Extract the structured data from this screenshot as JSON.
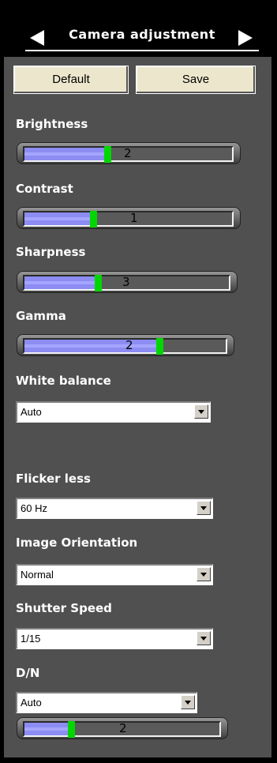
{
  "header": {
    "title": "Camera adjustment"
  },
  "buttons": {
    "default": "Default",
    "save": "Save"
  },
  "sliders": [
    {
      "id": "brightness",
      "label": "Brightness",
      "value": "2",
      "level": 0.4
    },
    {
      "id": "contrast",
      "label": "Contrast",
      "value": "1",
      "level": 0.33
    },
    {
      "id": "sharpness",
      "label": "Sharpness",
      "value": "3",
      "level": 0.36
    },
    {
      "id": "gamma",
      "label": "Gamma",
      "value": "2",
      "level": 0.67
    },
    {
      "id": "dn",
      "label": "",
      "value": "2",
      "level": 0.24
    }
  ],
  "selects": [
    {
      "id": "white-balance",
      "label": "White balance",
      "value": "Auto"
    },
    {
      "id": "flicker-less",
      "label": "Flicker less",
      "value": "60 Hz"
    },
    {
      "id": "image-orientation",
      "label": "Image Orientation",
      "value": "Normal"
    },
    {
      "id": "shutter-speed",
      "label": "Shutter Speed",
      "value": "1/15"
    },
    {
      "id": "dn-mode",
      "label": "D/N",
      "value": "Auto"
    }
  ],
  "colors": {
    "thumb": "#00D700",
    "fill": "#8C8CF2",
    "panel": "#505050",
    "button": "#ECE6CD"
  },
  "icons": {
    "prev": "left-arrow-icon",
    "next": "right-arrow-icon",
    "dropdown": "dropdown-arrow-icon"
  }
}
